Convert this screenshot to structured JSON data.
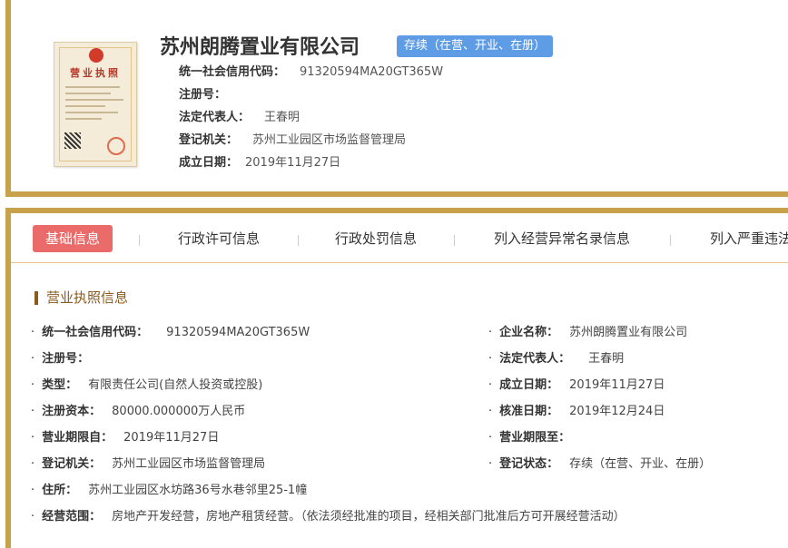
{
  "company": {
    "name": "苏州朗腾置业有限公司",
    "status": "存续（在营、开业、在册）",
    "license_image_caption": "营业执照",
    "credit_code_label": "统一社会信用代码：",
    "credit_code": "91320594MA20GT365W",
    "reg_no_label": "注册号：",
    "reg_no": "",
    "legal_rep_label": "法定代表人：",
    "legal_rep": "王春明",
    "authority_label": "登记机关：",
    "authority": "苏州工业园区市场监督管理局",
    "founded_label": "成立日期：",
    "founded": "2019年11月27日"
  },
  "tabs": [
    {
      "label": "基础信息",
      "active": true
    },
    {
      "label": "行政许可信息",
      "active": false
    },
    {
      "label": "行政处罚信息",
      "active": false
    },
    {
      "label": "列入经营异常名录信息",
      "active": false
    },
    {
      "label": "列入严重违法",
      "active": false
    }
  ],
  "section": {
    "title": "营业执照信息"
  },
  "details": {
    "left": [
      {
        "label": "统一社会信用代码：",
        "value": "91320594MA20GT365W"
      },
      {
        "label": "注册号：",
        "value": ""
      },
      {
        "label": "类型：",
        "value": "有限责任公司(自然人投资或控股)"
      },
      {
        "label": "注册资本：",
        "value": "80000.000000万人民币"
      },
      {
        "label": "营业期限自：",
        "value": "2019年11月27日"
      },
      {
        "label": "登记机关：",
        "value": "苏州工业园区市场监督管理局"
      },
      {
        "label": "住所：",
        "value": "苏州工业园区水坊路36号水巷邻里25-1幢"
      },
      {
        "label": "经营范围：",
        "value": "房地产开发经营，房地产租赁经营。（依法须经批准的项目，经相关部门批准后方可开展经营活动）"
      }
    ],
    "right": [
      {
        "label": "企业名称：",
        "value": "苏州朗腾置业有限公司"
      },
      {
        "label": "法定代表人：",
        "value": "王春明"
      },
      {
        "label": "成立日期：",
        "value": "2019年11月27日"
      },
      {
        "label": "核准日期：",
        "value": "2019年12月24日"
      },
      {
        "label": "营业期限至：",
        "value": ""
      },
      {
        "label": "登记状态：",
        "value": "存续（在营、开业、在册）"
      }
    ],
    "bullet": "·"
  },
  "colors": {
    "border_gold": "#c8a24a",
    "badge_blue": "#5e9ce6",
    "tab_active_red": "#eb6a6a",
    "section_brown": "#8a5a1e"
  }
}
